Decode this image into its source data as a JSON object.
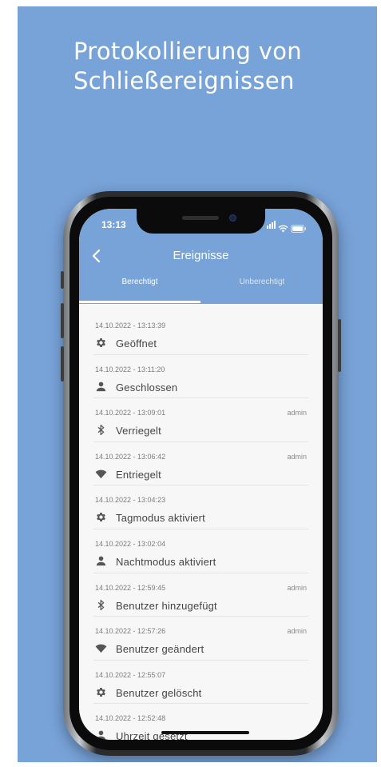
{
  "headline": {
    "line1": "Protokollierung von",
    "line2": "Schließereignissen"
  },
  "status_bar": {
    "time": "13:13"
  },
  "nav": {
    "title": "Ereignisse"
  },
  "tabs": [
    {
      "label": "Berechtigt",
      "active": true
    },
    {
      "label": "Unberechtigt",
      "active": false
    }
  ],
  "events": [
    {
      "timestamp": "14.10.2022 - 13:13:39",
      "label": "Geöffnet",
      "icon": "gear-icon",
      "user": ""
    },
    {
      "timestamp": "14.10.2022 - 13:11:20",
      "label": "Geschlossen",
      "icon": "person-icon",
      "user": ""
    },
    {
      "timestamp": "14.10.2022 - 13:09:01",
      "label": "Verriegelt",
      "icon": "bluetooth-icon",
      "user": "admin"
    },
    {
      "timestamp": "14.10.2022 - 13:06:42",
      "label": "Entriegelt",
      "icon": "wifi-icon",
      "user": "admin"
    },
    {
      "timestamp": "14.10.2022 - 13:04:23",
      "label": "Tagmodus aktiviert",
      "icon": "gear-icon",
      "user": ""
    },
    {
      "timestamp": "14.10.2022 - 13:02:04",
      "label": "Nachtmodus aktiviert",
      "icon": "person-icon",
      "user": ""
    },
    {
      "timestamp": "14.10.2022 - 12:59:45",
      "label": "Benutzer hinzugefügt",
      "icon": "bluetooth-icon",
      "user": "admin"
    },
    {
      "timestamp": "14.10.2022 - 12:57:26",
      "label": "Benutzer geändert",
      "icon": "wifi-icon",
      "user": "admin"
    },
    {
      "timestamp": "14.10.2022 - 12:55:07",
      "label": "Benutzer gelöscht",
      "icon": "gear-icon",
      "user": ""
    },
    {
      "timestamp": "14.10.2022 - 12:52:48",
      "label": "Uhrzeit gesetzt",
      "icon": "person-icon",
      "user": ""
    }
  ],
  "colors": {
    "accent": "#78a3d9",
    "list_background": "#f7f7f7",
    "icon": "#555555"
  }
}
